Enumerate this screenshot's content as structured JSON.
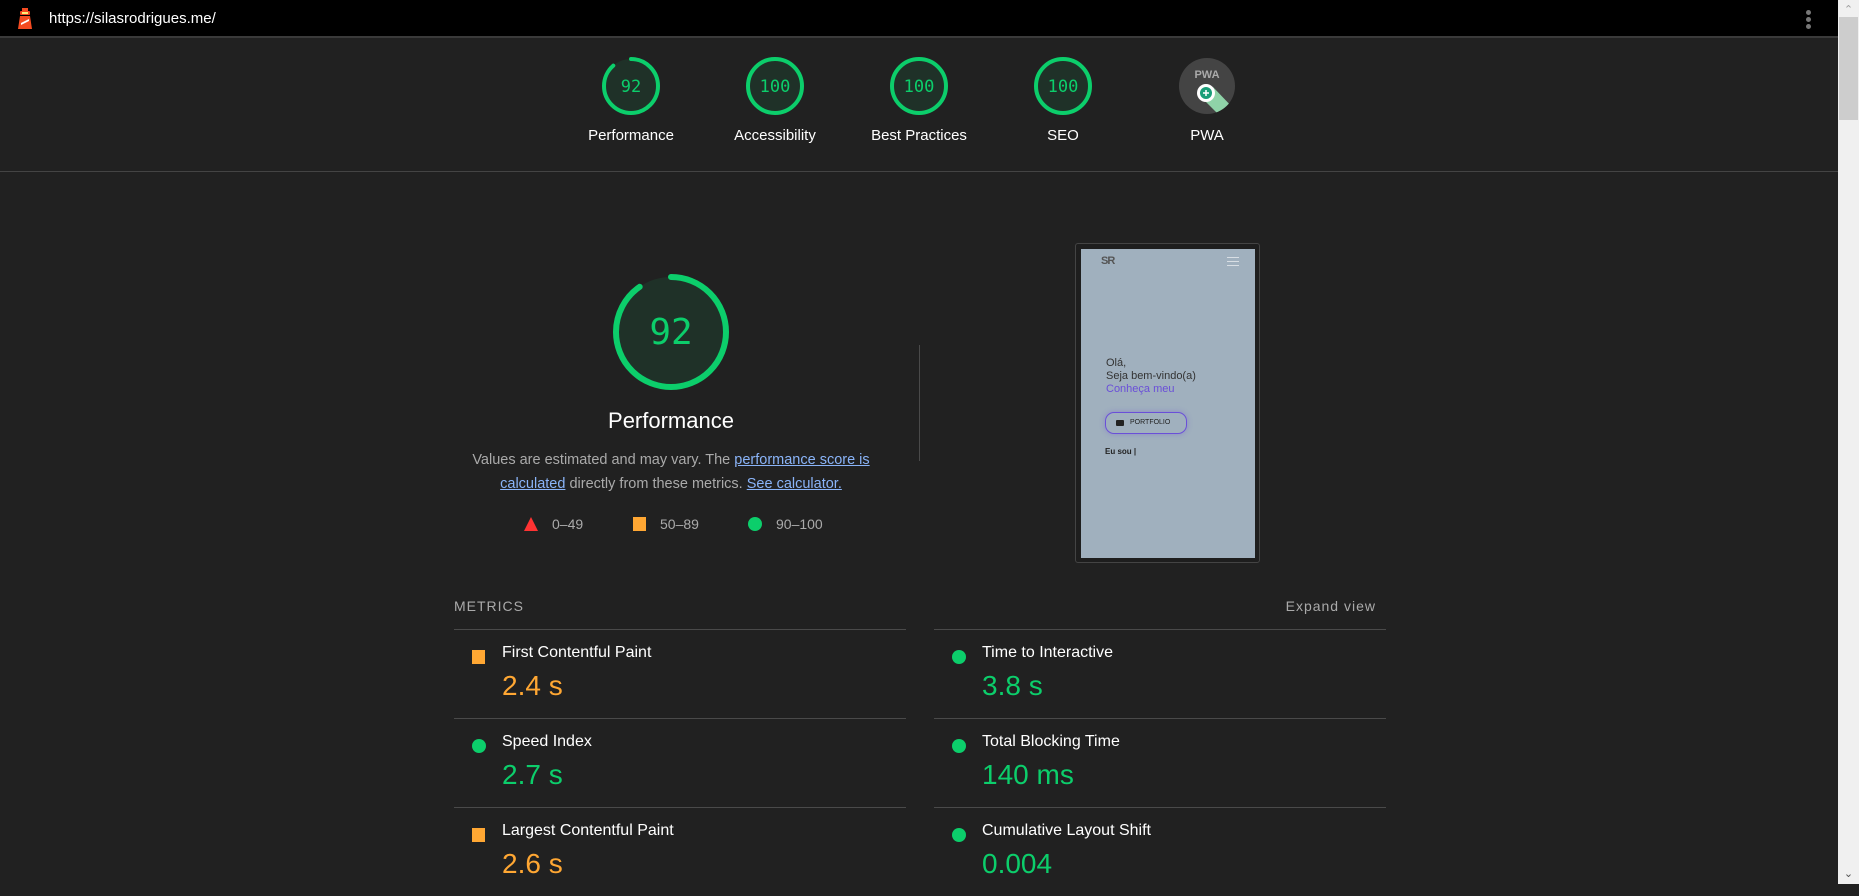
{
  "topbar": {
    "url": "https://silasrodrigues.me/",
    "logo_icon": "lighthouse-icon",
    "menu_icon": "kebab-menu-icon"
  },
  "colors": {
    "pass": "#0cce6b",
    "average": "#ffa733",
    "fail": "#ff3333",
    "link": "#8ab4f8",
    "background": "#212121"
  },
  "gauges": [
    {
      "label": "Performance",
      "score": "92",
      "value": 92
    },
    {
      "label": "Accessibility",
      "score": "100",
      "value": 100
    },
    {
      "label": "Best Practices",
      "score": "100",
      "value": 100
    },
    {
      "label": "SEO",
      "score": "100",
      "value": 100
    },
    {
      "label": "PWA",
      "badge_text": "PWA",
      "icon": "pwa-badge-icon"
    }
  ],
  "performance": {
    "score": "92",
    "score_value": 92,
    "title": "Performance",
    "desc_part1": "Values are estimated and may vary. The ",
    "desc_link1": "performance score is calculated",
    "desc_part2": " directly from these metrics. ",
    "desc_link2": "See calculator.",
    "legend": [
      {
        "range": "0–49",
        "shape": "triangle"
      },
      {
        "range": "50–89",
        "shape": "square"
      },
      {
        "range": "90–100",
        "shape": "circle"
      }
    ]
  },
  "screenshot": {
    "logo": "SR",
    "line1": "Olá,",
    "line2": "Seja bem-vindo(a)",
    "line3": "Conheça meu",
    "button": "PORTFOLIO",
    "typing": "Eu sou |"
  },
  "metrics": {
    "title": "METRICS",
    "expand_label": "Expand view",
    "items": [
      {
        "name": "First Contentful Paint",
        "value": "2.4 s",
        "rating": "average"
      },
      {
        "name": "Time to Interactive",
        "value": "3.8 s",
        "rating": "pass"
      },
      {
        "name": "Speed Index",
        "value": "2.7 s",
        "rating": "pass"
      },
      {
        "name": "Total Blocking Time",
        "value": "140 ms",
        "rating": "pass"
      },
      {
        "name": "Largest Contentful Paint",
        "value": "2.6 s",
        "rating": "average"
      },
      {
        "name": "Cumulative Layout Shift",
        "value": "0.004",
        "rating": "pass"
      }
    ]
  }
}
